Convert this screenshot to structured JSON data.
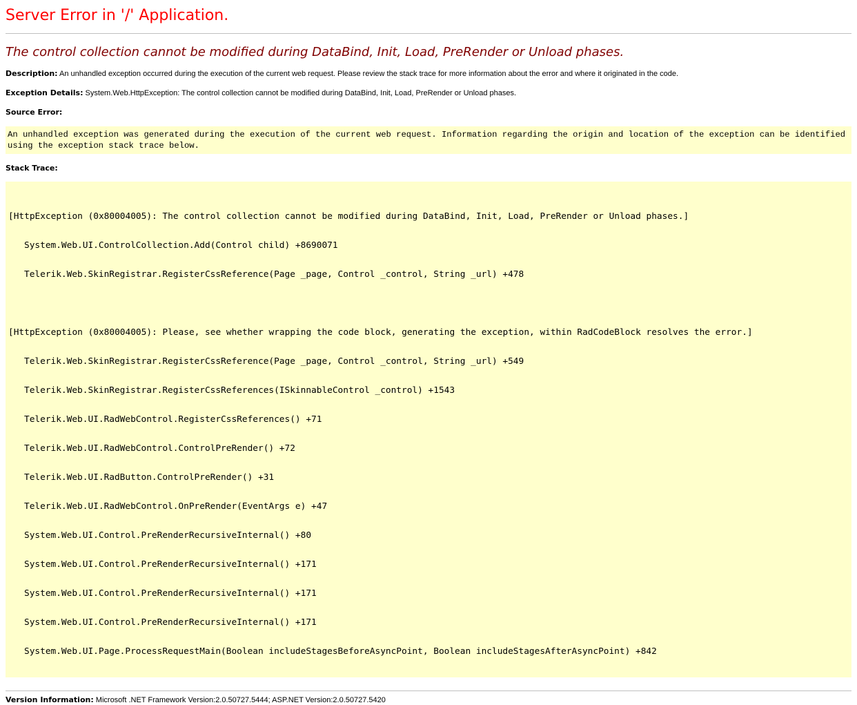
{
  "colors": {
    "title": "#ff0000",
    "error_message": "#800000",
    "code_background": "#ffffcc",
    "rule": "#c0c0c0"
  },
  "page": {
    "title": "Server Error in '/' Application.",
    "error_message": "The control collection cannot be modified during DataBind, Init, Load, PreRender or Unload phases."
  },
  "description": {
    "label": "Description:",
    "text": "An unhandled exception occurred during the execution of the current web request. Please review the stack trace for more information about the error and where it originated in the code."
  },
  "exception_details": {
    "label": "Exception Details:",
    "text": "System.Web.HttpException: The control collection cannot be modified during DataBind, Init, Load, PreRender or Unload phases."
  },
  "source_error": {
    "label": "Source Error:",
    "text": "An unhandled exception was generated during the execution of the current web request. Information regarding the origin and location of the exception can be identified using the exception stack trace below."
  },
  "stack_trace": {
    "label": "Stack Trace:",
    "blocks": [
      {
        "header": "[HttpException (0x80004005): The control collection cannot be modified during DataBind, Init, Load, PreRender or Unload phases.]",
        "frames": [
          "System.Web.UI.ControlCollection.Add(Control child) +8690071",
          "Telerik.Web.SkinRegistrar.RegisterCssReference(Page _page, Control _control, String _url) +478"
        ]
      },
      {
        "header": "[HttpException (0x80004005): Please, see whether wrapping the code block, generating the exception, within RadCodeBlock resolves the error.]",
        "frames": [
          "Telerik.Web.SkinRegistrar.RegisterCssReference(Page _page, Control _control, String _url) +549",
          "Telerik.Web.SkinRegistrar.RegisterCssReferences(ISkinnableControl _control) +1543",
          "Telerik.Web.UI.RadWebControl.RegisterCssReferences() +71",
          "Telerik.Web.UI.RadWebControl.ControlPreRender() +72",
          "Telerik.Web.UI.RadButton.ControlPreRender() +31",
          "Telerik.Web.UI.RadWebControl.OnPreRender(EventArgs e) +47",
          "System.Web.UI.Control.PreRenderRecursiveInternal() +80",
          "System.Web.UI.Control.PreRenderRecursiveInternal() +171",
          "System.Web.UI.Control.PreRenderRecursiveInternal() +171",
          "System.Web.UI.Control.PreRenderRecursiveInternal() +171",
          "System.Web.UI.Page.ProcessRequestMain(Boolean includeStagesBeforeAsyncPoint, Boolean includeStagesAfterAsyncPoint) +842"
        ]
      }
    ]
  },
  "version_information": {
    "label": "Version Information:",
    "text": "Microsoft .NET Framework Version:2.0.50727.5444; ASP.NET Version:2.0.50727.5420"
  }
}
